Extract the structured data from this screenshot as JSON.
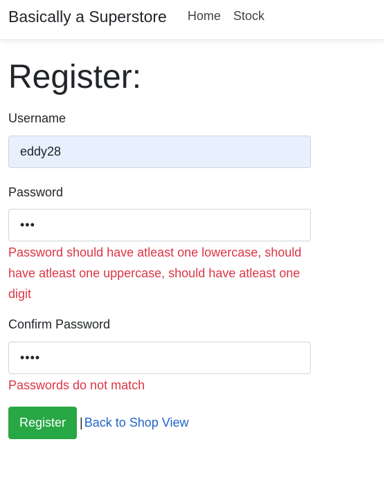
{
  "navbar": {
    "brand": "Basically a Superstore",
    "links": [
      "Home",
      "Stock"
    ]
  },
  "page": {
    "title": "Register:"
  },
  "form": {
    "username": {
      "label": "Username",
      "value": "eddy28"
    },
    "password": {
      "label": "Password",
      "masked_value": "•••",
      "error": "Password should have atleast one lowercase, should have atleast one uppercase, should have atleast one digit"
    },
    "confirm_password": {
      "label": "Confirm Password",
      "masked_value": "••••",
      "error": "Passwords do not match"
    },
    "submit_label": "Register",
    "separator": "|",
    "back_link": "Back to Shop View"
  },
  "colors": {
    "error": "#dc3545",
    "success_button": "#28a745",
    "link": "#1f64c8",
    "autofill_bg": "#e8f0fe"
  }
}
